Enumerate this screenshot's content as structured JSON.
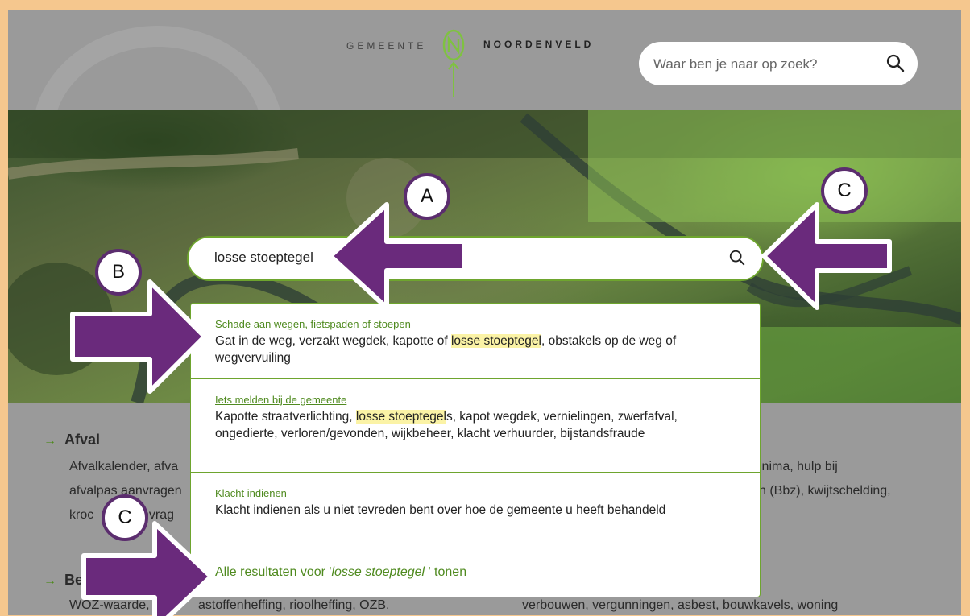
{
  "header": {
    "logo_word1": "GEMEENTE",
    "logo_word2": "NOORDENVELD",
    "search_placeholder": "Waar ben je naar op zoek?",
    "search_icon": "search-icon"
  },
  "search": {
    "query": "losse stoeptegel",
    "icon": "search-icon"
  },
  "results": [
    {
      "title": "Schade aan wegen, fietspaden of stoepen",
      "desc_before": "Gat in de weg, verzakt wegdek, kapotte of ",
      "desc_highlight": "losse stoeptegel",
      "desc_after": ", obstakels op de weg of wegvervuiling"
    },
    {
      "title": "Iets melden bij de gemeente",
      "desc_before": "Kapotte straatverlichting, ",
      "desc_highlight": "losse stoeptegel",
      "desc_after": "s, kapot wegdek, vernielingen, zwerfafval, ongedierte, verloren/gevonden, wijkbeheer, klacht verhuurder, bijstandsfraude"
    },
    {
      "title": "Klacht indienen",
      "desc_before": "Klacht indienen als u niet tevreden bent over hoe de gemeente u heeft behandeld",
      "desc_highlight": "",
      "desc_after": ""
    }
  ],
  "all_results": {
    "prefix": "Alle resultaten voor '",
    "query": "losse stoeptegel",
    "suffix": " ' tonen"
  },
  "categories": {
    "afval_title": "Afval",
    "afval_line1": "Afvalkalender, afva",
    "afval_line2": "afvalpas aanvragen",
    "afval_line3": "kroc",
    "afval_line3b": "nvrag",
    "b_title": "Be",
    "b_line1a": "WOZ-waarde, a",
    "b_line1b": "astoffenheffing, rioolheffing, OZB,",
    "right_line1": "inima, hulp bij",
    "right_line2": "n (Bbz), kwijtschelding,",
    "right_line3": "verbouwen, vergunningen, asbest, bouwkavels, woning"
  },
  "annotations": {
    "badge_a": "A",
    "badge_b": "B",
    "badge_c1": "C",
    "badge_c2": "C",
    "arrow_color": "#6a2a7c",
    "badge_border_color": "#5b2d6e"
  },
  "colors": {
    "accent_green": "#4f8a1f",
    "frame": "#f5c78e",
    "header_bg": "#9a9a9a",
    "highlight": "#fbf3a6"
  }
}
